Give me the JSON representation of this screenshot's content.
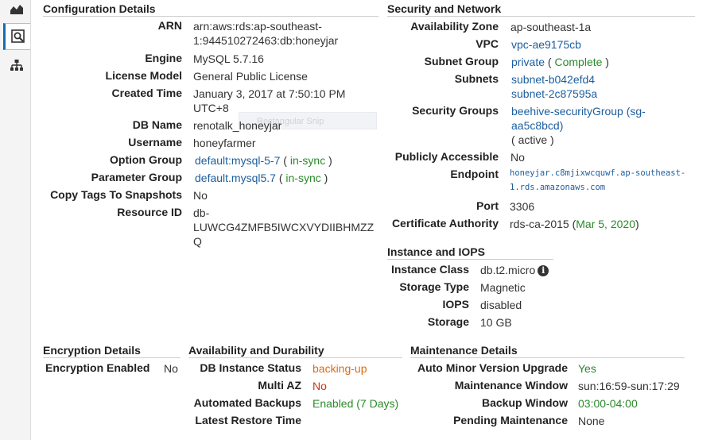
{
  "sidebar": {
    "icons": [
      "chart-icon",
      "inspect-icon",
      "hierarchy-icon"
    ]
  },
  "snip_overlay": "Rectangular Snip",
  "config": {
    "title": "Configuration Details",
    "arn_label": "ARN",
    "arn_value_line1": "arn:aws:rds:ap-southeast-",
    "arn_value_line2": "1:944510272463:db:honeyjar",
    "engine_label": "Engine",
    "engine_value": "MySQL 5.7.16",
    "license_label": "License Model",
    "license_value": "General Public License",
    "created_label": "Created Time",
    "created_value_line1": "January 3, 2017 at 7:50:10 PM",
    "created_value_line2": "UTC+8",
    "dbname_label": "DB Name",
    "dbname_value": "renotalk_honeyjar",
    "username_label": "Username",
    "username_value": "honeyfarmer",
    "option_label": "Option Group",
    "option_value": "default:mysql-5-7",
    "option_status": "in-sync",
    "param_label": "Parameter Group",
    "param_value": "default.mysql5.7",
    "param_status": "in-sync",
    "copytags_label": "Copy Tags To Snapshots",
    "copytags_value": "No",
    "resource_label": "Resource ID",
    "resource_value_line1": "db-",
    "resource_value_line2": "LUWCG4ZMFB5IWCXVYDIIBHMZZ",
    "resource_value_line3": "Q"
  },
  "security": {
    "title": "Security and Network",
    "az_label": "Availability Zone",
    "az_value": "ap-southeast-1a",
    "vpc_label": "VPC",
    "vpc_value": "vpc-ae9175cb",
    "subnet_group_label": "Subnet Group",
    "subnet_group_value": "private",
    "subnet_group_status": "Complete",
    "subnets_label": "Subnets",
    "subnets": [
      "subnet-b042efd4",
      "subnet-2c87595a"
    ],
    "sg_label": "Security Groups",
    "sg_value_line1": "beehive-securityGroup (sg-",
    "sg_value_line2": "aa5c8bcd)",
    "sg_status": "active",
    "public_label": "Publicly Accessible",
    "public_value": "No",
    "endpoint_label": "Endpoint",
    "endpoint_line1": "honeyjar.c8mjixwcquwf.ap-southeast-",
    "endpoint_line2": "1.rds.amazonaws.com",
    "port_label": "Port",
    "port_value": "3306",
    "ca_label": "Certificate Authority",
    "ca_value": "rds-ca-2015",
    "ca_date": "Mar 5, 2020"
  },
  "instance": {
    "title": "Instance and IOPS",
    "class_label": "Instance Class",
    "class_value": "db.t2.micro",
    "storage_type_label": "Storage Type",
    "storage_type_value": "Magnetic",
    "iops_label": "IOPS",
    "iops_value": "disabled",
    "storage_label": "Storage",
    "storage_value": "10 GB"
  },
  "encryption": {
    "title": "Encryption Details",
    "enabled_label": "Encryption Enabled",
    "enabled_value": "No"
  },
  "availability": {
    "title": "Availability and Durability",
    "status_label": "DB Instance Status",
    "status_value": "backing-up",
    "multiaz_label": "Multi AZ",
    "multiaz_value": "No",
    "backups_label": "Automated Backups",
    "backups_value": "Enabled (7 Days)",
    "restore_label": "Latest Restore Time",
    "restore_value": ""
  },
  "maintenance": {
    "title": "Maintenance Details",
    "auto_minor_label": "Auto Minor Version Upgrade",
    "auto_minor_value": "Yes",
    "window_label": "Maintenance Window",
    "window_value": "sun:16:59-sun:17:29",
    "backup_window_label": "Backup Window",
    "backup_window_value": "03:00-04:00",
    "pending_label": "Pending Maintenance",
    "pending_value": "None"
  },
  "colors": {
    "link": "#1c5e9e",
    "green": "#2a8a2a",
    "orange": "#dd6b10",
    "red": "#d13212"
  }
}
